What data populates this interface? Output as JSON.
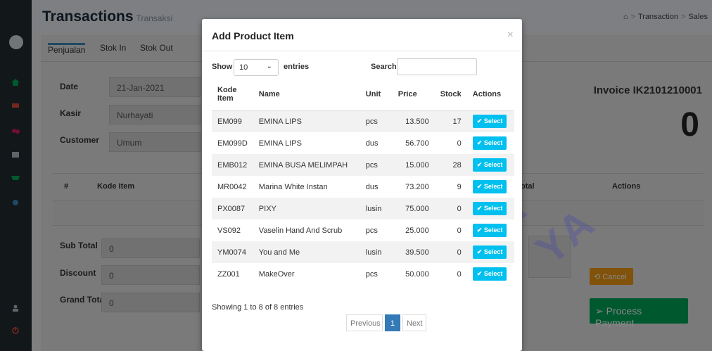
{
  "header": {
    "title": "Transactions",
    "subtitle": "Transaksi",
    "breadcrumb": [
      "Transaction",
      "Sales"
    ]
  },
  "tabs": [
    "Penjualan",
    "Stok In",
    "Stok Out"
  ],
  "form": {
    "date_label": "Date",
    "date_value": "21-Jan-2021",
    "kasir_label": "Kasir",
    "kasir_value": "Nurhayati",
    "customer_label": "Customer",
    "customer_value": "Umum"
  },
  "invoice": {
    "label": "Invoice IK2101210001",
    "total": "0"
  },
  "cart_table": {
    "col_no": "#",
    "col_kode": "Kode Item",
    "col_total": "otal",
    "col_actions": "Actions"
  },
  "totals": {
    "subtotal_label": "Sub Total",
    "subtotal_value": "0",
    "discount_label": "Discount",
    "discount_value": "0",
    "grandtotal_label": "Grand Total",
    "grandtotal_value": "0"
  },
  "buttons": {
    "cancel": "Cancel",
    "process": "Process Payment"
  },
  "modal": {
    "title": "Add Product Item",
    "close": "×",
    "show_label": "Show",
    "entries_value": "10",
    "entries_label": "entries",
    "search_label": "Search:",
    "search_value": "",
    "columns": [
      "Kode Item",
      "Name",
      "Unit",
      "Price",
      "Stock",
      "Actions"
    ],
    "rows": [
      {
        "kode": "EM099",
        "name": "EMINA LIPS",
        "unit": "pcs",
        "price": "13.500",
        "stock": "17"
      },
      {
        "kode": "EM099D",
        "name": "EMINA LIPS",
        "unit": "dus",
        "price": "56.700",
        "stock": "0"
      },
      {
        "kode": "EMB012",
        "name": "EMINA BUSA MELIMPAH",
        "unit": "pcs",
        "price": "15.000",
        "stock": "28"
      },
      {
        "kode": "MR0042",
        "name": "Marina White Instan",
        "unit": "dus",
        "price": "73.200",
        "stock": "9"
      },
      {
        "kode": "PX0087",
        "name": "PIXY",
        "unit": "lusin",
        "price": "75.000",
        "stock": "0"
      },
      {
        "kode": "VS092",
        "name": "Vaselin Hand And Scrub",
        "unit": "pcs",
        "price": "25.000",
        "stock": "0"
      },
      {
        "kode": "YM0074",
        "name": "You and Me",
        "unit": "lusin",
        "price": "39.500",
        "stock": "0"
      },
      {
        "kode": "ZZ001",
        "name": "MakeOver",
        "unit": "pcs",
        "price": "50.000",
        "stock": "0"
      }
    ],
    "select_label": "Select",
    "showing": "Showing 1 to 8 of 8 entries",
    "pagination": {
      "prev": "Previous",
      "page": "1",
      "next": "Next"
    }
  },
  "watermark": "AKTEK  ATIKA  YA",
  "colors": {
    "sidebar": "#222d32",
    "accent": "#3c8dbc",
    "select": "#00c0ef",
    "cancel": "#f39c12",
    "process": "#00a65a"
  }
}
